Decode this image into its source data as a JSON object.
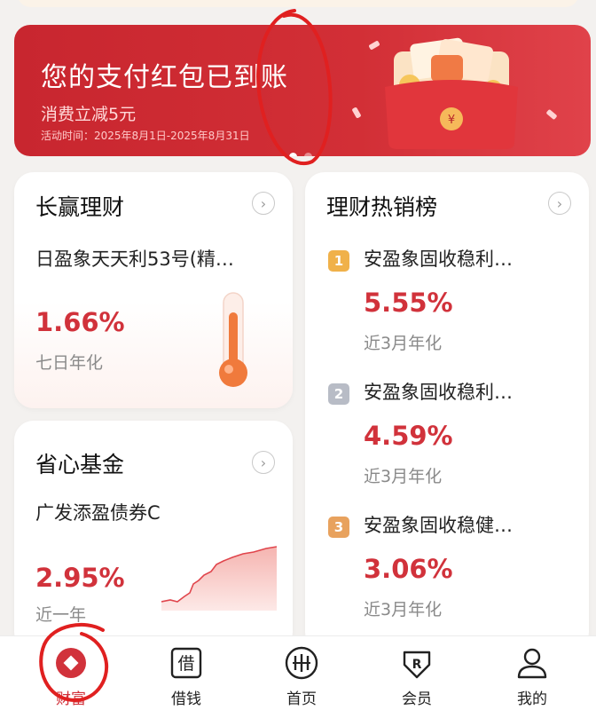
{
  "banner": {
    "title": "您的支付红包已到账",
    "subtitle": "消费立减5元",
    "date": "活动时间：2025年8月1日-2025年8月31日"
  },
  "cards": {
    "changying": {
      "title": "长赢理财",
      "product": "日盈象天天利53号(精…",
      "rate": "1.66%",
      "rate_label": "七日年化"
    },
    "shengxin": {
      "title": "省心基金",
      "product": "广发添盈债券C",
      "rate": "2.95%",
      "rate_label": "近一年"
    },
    "hot": {
      "title": "理财热销榜",
      "items": [
        {
          "rank": "1",
          "name": "安盈象固收稳利…",
          "rate": "5.55%",
          "label": "近3月年化",
          "color": "#f0b14a"
        },
        {
          "rank": "2",
          "name": "安盈象固收稳利…",
          "rate": "4.59%",
          "label": "近3月年化",
          "color": "#b8bcc6"
        },
        {
          "rank": "3",
          "name": "安盈象固收稳健…",
          "rate": "3.06%",
          "label": "近3月年化",
          "color": "#e8a25e"
        }
      ]
    }
  },
  "tabbar": {
    "items": [
      {
        "label": "财富",
        "icon": "wealth-icon"
      },
      {
        "label": "借钱",
        "icon": "borrow-icon"
      },
      {
        "label": "首页",
        "icon": "home-icon"
      },
      {
        "label": "会员",
        "icon": "member-icon"
      },
      {
        "label": "我的",
        "icon": "profile-icon"
      }
    ],
    "borrow_glyph": "借"
  },
  "colors": {
    "accent": "#d1323b",
    "banner": "#c8262f"
  }
}
